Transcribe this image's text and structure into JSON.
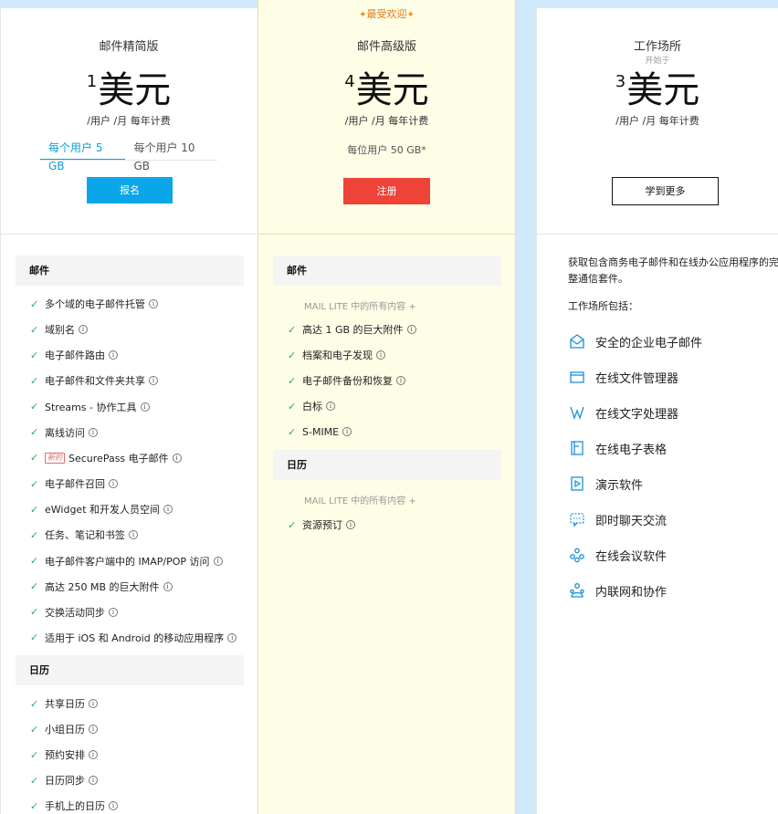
{
  "lite": {
    "name": "邮件精简版",
    "price_sup": "1",
    "price": "美元",
    "per": "/用户 /月 每年计费",
    "tabs": [
      "每个用户 5 GB",
      "每个用户 10 GB"
    ],
    "button": "报名",
    "mail_header": "邮件",
    "mail_features": [
      "多个域的电子邮件托管",
      "域别名",
      "电子邮件路由",
      "电子邮件和文件夹共享",
      "Streams - 协作工具",
      "离线访问",
      "SecurePass 电子邮件",
      "电子邮件召回",
      "eWidget 和开发人员空间",
      "任务、笔记和书签",
      "电子邮件客户端中的 IMAP/POP 访问",
      "高达 250 MB 的巨大附件",
      "交换活动同步",
      "适用于 iOS 和 Android 的移动应用程序"
    ],
    "new_badge": "新的",
    "cal_header": "日历",
    "cal_features": [
      "共享日历",
      "小组日历",
      "预约安排",
      "日历同步",
      "手机上的日历"
    ]
  },
  "premium": {
    "tag": "最受欢迎",
    "name": "邮件高级版",
    "price_sup": "4",
    "price": "美元",
    "per": "/用户 /月 每年计费",
    "storage": "每位用户 50 GB*",
    "button": "注册",
    "mail_header": "邮件",
    "mail_sub": "MAIL LITE 中的所有内容 +",
    "mail_features": [
      "高达 1 GB 的巨大附件",
      "档案和电子发现",
      "电子邮件备份和恢复",
      "白标",
      "S-MIME"
    ],
    "cal_header": "日历",
    "cal_sub": "MAIL LITE 中的所有内容 +",
    "cal_features": [
      "资源预订"
    ]
  },
  "workplace": {
    "name": "工作场所",
    "start_from": "开始于",
    "price_sup": "3",
    "price": "美元",
    "per": "/用户 /月 每年计费",
    "button": "学到更多",
    "desc": "获取包含商务电子邮件和在线办公应用程序的完整通信套件。",
    "includes": "工作场所包括：",
    "items": [
      {
        "label": "安全的企业电子邮件",
        "icon": "mail-icon"
      },
      {
        "label": "在线文件管理器",
        "icon": "folder-icon"
      },
      {
        "label": "在线文字处理器",
        "icon": "writer-icon"
      },
      {
        "label": "在线电子表格",
        "icon": "sheet-icon"
      },
      {
        "label": "演示软件",
        "icon": "show-icon"
      },
      {
        "label": "即时聊天交流",
        "icon": "chat-icon"
      },
      {
        "label": "在线会议软件",
        "icon": "meeting-icon"
      },
      {
        "label": "内联网和协作",
        "icon": "connect-icon"
      }
    ]
  },
  "colors": {
    "accent_blue": "#0aa6e8",
    "accent_red": "#ee4338",
    "check_green": "#2eaa5a",
    "fav_orange": "#e27a1f",
    "premium_bg": "#fefde6"
  }
}
